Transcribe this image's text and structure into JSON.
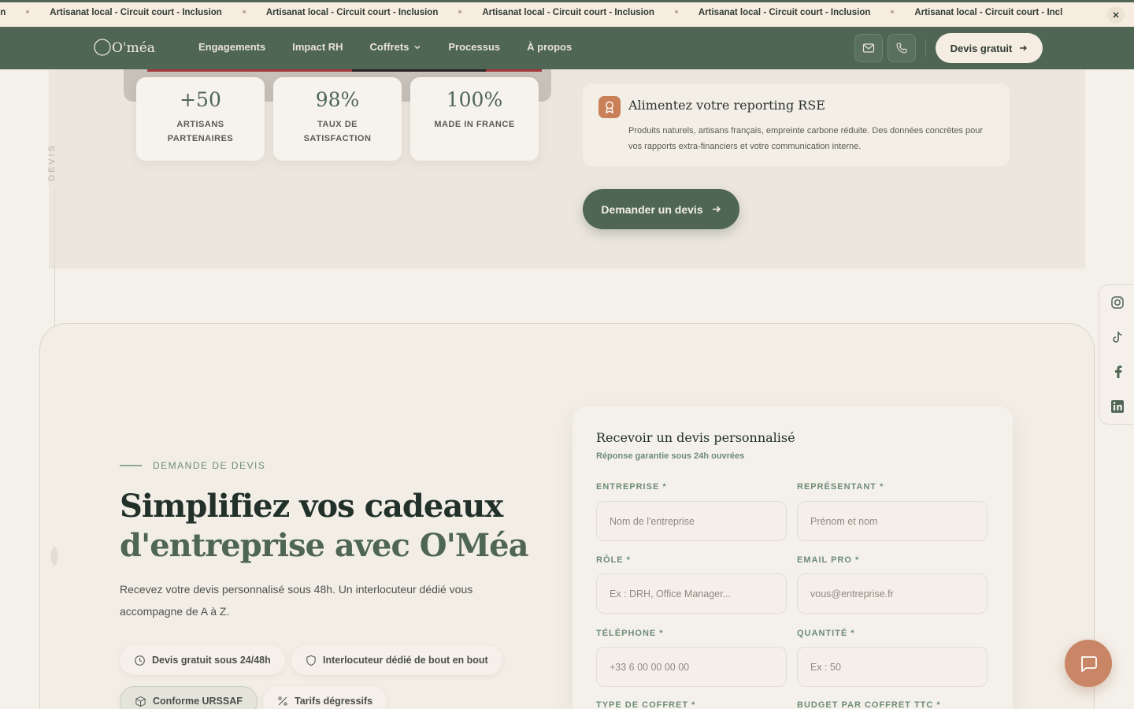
{
  "ticker": {
    "items": [
      "nclusion",
      "Artisanat local - Circuit court - Inclusion",
      "Artisanat local - Circuit court - Inclusion",
      "Artisanat local - Circuit court - Inclusion",
      "Artisanat local - Circuit court - Inclusion",
      "Artisanat local - Circuit court - Incl"
    ],
    "close_icon": "close-icon"
  },
  "header": {
    "logo_text": "O'méa",
    "nav": [
      {
        "label": "Engagements"
      },
      {
        "label": "Impact RH"
      },
      {
        "label": "Coffrets",
        "icon": "chevron-down-icon"
      },
      {
        "label": "Processus"
      },
      {
        "label": "À propos"
      }
    ],
    "icons": [
      "mail-icon",
      "phone-icon"
    ],
    "cta_label": "Devis gratuit"
  },
  "stats": [
    {
      "value": "+50",
      "label": "ARTISANS PARTENAIRES"
    },
    {
      "value": "98%",
      "label": "TAUX DE SATISFACTION"
    },
    {
      "value": "100%",
      "label": "MADE IN FRANCE"
    }
  ],
  "rse": {
    "icon": "award-icon",
    "title": "Alimentez votre reporting RSE",
    "text": "Produits naturels, artisans français, empreinte carbone réduite. Des données concrètes pour vos rapports extra-financiers et votre communication interne."
  },
  "demand_button": "Demander un devis",
  "side_label": "DEVIS",
  "hero": {
    "eyebrow": "DEMANDE DE DEVIS",
    "headline_part1": "Simplifiez vos cadeaux",
    "headline_part2": "d'entreprise avec O'Méa",
    "lead": "Recevez votre devis personnalisé sous 48h. Un interlocuteur dédié vous accompagne de A à Z.",
    "chips": [
      {
        "label": "Devis gratuit sous 24/48h",
        "icon": "clock-icon"
      },
      {
        "label": "Interlocuteur dédié de bout en bout",
        "icon": "shield-icon"
      },
      {
        "label": "Conforme URSSAF",
        "icon": "box-icon"
      },
      {
        "label": "Tarifs dégressifs",
        "icon": "percent-icon"
      }
    ]
  },
  "form": {
    "title": "Recevoir un devis personnalisé",
    "subtitle": "Réponse garantie sous 24h ouvrées",
    "fields": [
      {
        "label": "ENTREPRISE *",
        "placeholder": "Nom de l'entreprise",
        "value": ""
      },
      {
        "label": "REPRÉSENTANT *",
        "placeholder": "Prénom et nom",
        "value": ""
      },
      {
        "label": "RÔLE *",
        "placeholder": "Ex : DRH, Office Manager...",
        "value": ""
      },
      {
        "label": "EMAIL PRO *",
        "placeholder": "vous@entreprise.fr",
        "value": ""
      },
      {
        "label": "TÉLÉPHONE *",
        "placeholder": "+33 6 00 00 00 00",
        "value": ""
      },
      {
        "label": "QUANTITÉ *",
        "placeholder": "Ex : 50",
        "value": ""
      },
      {
        "label": "TYPE DE COFFRET *"
      },
      {
        "label": "BUDGET PAR COFFRET TTC *"
      }
    ]
  },
  "social": [
    "instagram-icon",
    "tiktok-icon",
    "facebook-icon",
    "linkedin-icon"
  ],
  "chat_icon": "chat-icon",
  "colors": {
    "primary": "#4f6655",
    "accent": "#c98666",
    "background": "#f4f1ea",
    "ticker_bg": "#f7ece0"
  }
}
